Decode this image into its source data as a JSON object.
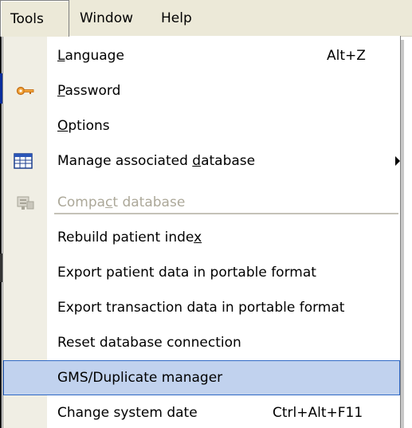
{
  "menubar": {
    "tools": "Tools",
    "window": "Window",
    "help": "Help"
  },
  "menu": {
    "language": {
      "pre": "",
      "mnemonic": "L",
      "post": "anguage",
      "shortcut": "Alt+Z"
    },
    "password": {
      "pre": "",
      "mnemonic": "P",
      "post": "assword"
    },
    "options": {
      "pre": "",
      "mnemonic": "O",
      "post": "ptions"
    },
    "manage_db": {
      "pre": "Manage associated ",
      "mnemonic": "d",
      "post": "atabase"
    },
    "compact_db": {
      "pre": "Compa",
      "mnemonic": "c",
      "post": "t database"
    },
    "rebuild_index": {
      "pre": "Rebuild patient inde",
      "mnemonic": "x",
      "post": ""
    },
    "export_patient": {
      "label": "Export patient data in portable format"
    },
    "export_transaction": {
      "label": "Export transaction data in portable format"
    },
    "reset_connection": {
      "label": "Reset database connection"
    },
    "gms_duplicate": {
      "label": "GMS/Duplicate manager"
    },
    "change_date": {
      "label": "Change system date",
      "shortcut": "Ctrl+Alt+F11"
    }
  },
  "icons": {
    "password": "key-icon",
    "manage_db": "table-grid-icon",
    "compact_db": "compact-database-icon",
    "submenu": "submenu-arrow-icon"
  },
  "colors": {
    "highlight_bg": "#c1d2ee",
    "highlight_border": "#316ac5",
    "disabled_text": "#aca899",
    "menubar_bg": "#ece9d8"
  }
}
